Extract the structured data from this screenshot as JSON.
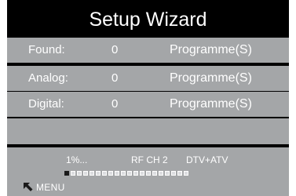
{
  "title": "Setup Wizard",
  "rows": [
    {
      "label": "Found:",
      "count": "0",
      "unit": "Programme(S)"
    },
    {
      "label": "Analog:",
      "count": "0",
      "unit": "Programme(S)"
    },
    {
      "label": "Digital:",
      "count": "0",
      "unit": "Programme(S)"
    }
  ],
  "status": {
    "progress_text": "1%...",
    "channel": "RF CH 2",
    "mode": "DTV+ATV",
    "progress_filled_segments": 1,
    "progress_total_segments": 20,
    "menu_label": "MENU",
    "menu_icon": "return-arrow-icon"
  },
  "colors": {
    "background": "#000000",
    "row": "#a4a6a8",
    "text": "#ffffff"
  }
}
